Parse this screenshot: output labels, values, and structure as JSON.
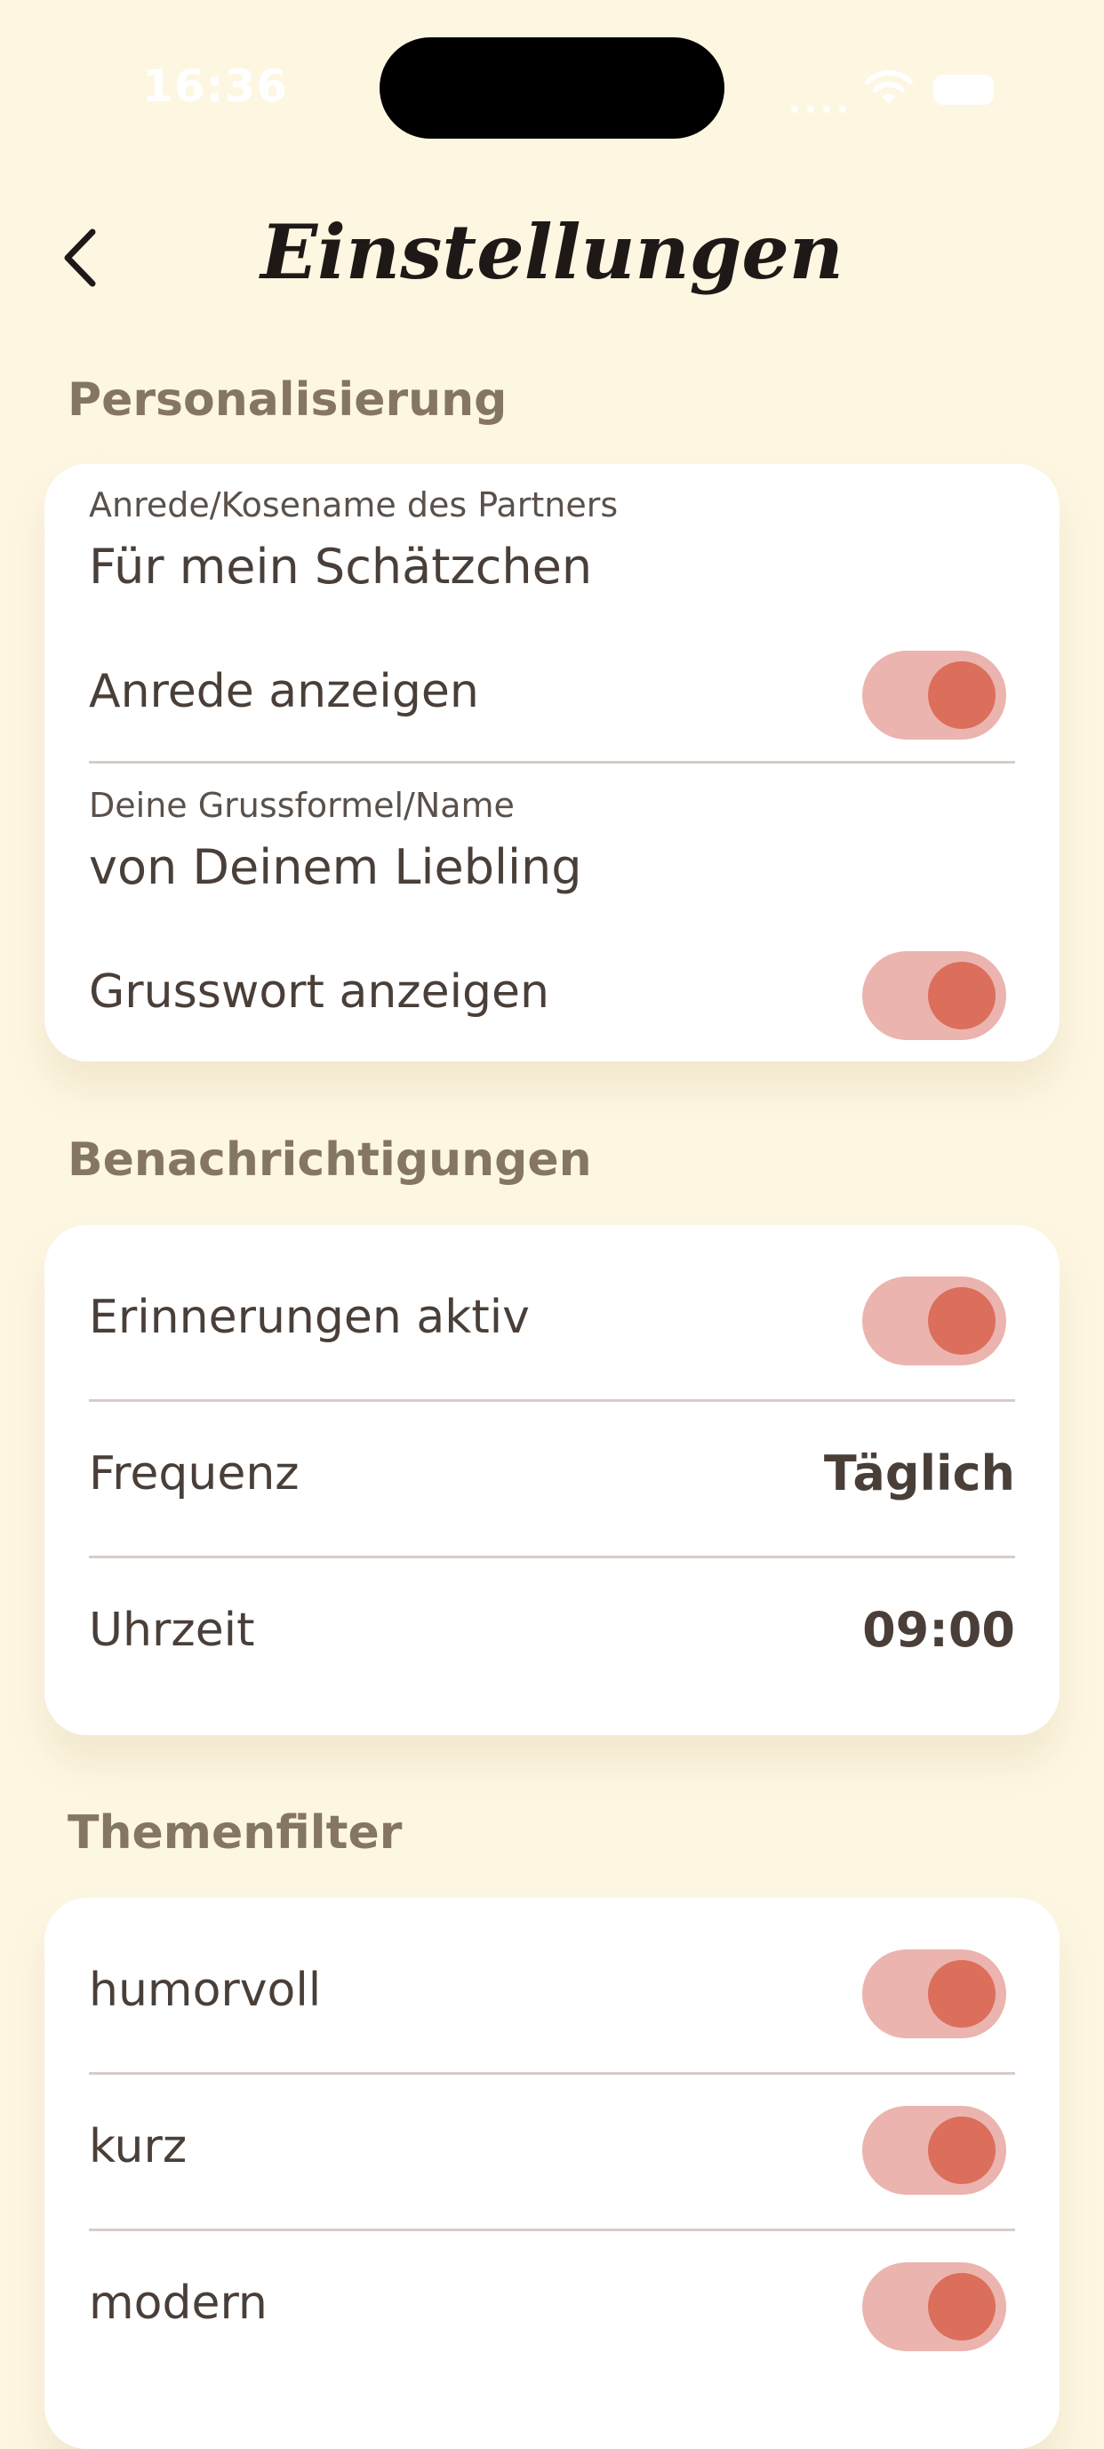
{
  "status_bar": {
    "time": "16:36"
  },
  "header": {
    "title": "Einstellungen",
    "back_icon": "chevron-left-icon"
  },
  "sections": {
    "personalization": {
      "title": "Personalisierung",
      "partner_label": "Anrede/Kosename des Partners",
      "partner_value": "Für mein Schätzchen",
      "show_salutation_label": "Anrede anzeigen",
      "show_salutation_on": true,
      "greeting_label": "Deine Grussformel/Name",
      "greeting_value": "von Deinem Liebling",
      "show_greeting_label": "Grusswort anzeigen",
      "show_greeting_on": true
    },
    "notifications": {
      "title": "Benachrichtigungen",
      "reminders_label": "Erinnerungen aktiv",
      "reminders_on": true,
      "frequency_label": "Frequenz",
      "frequency_value": "Täglich",
      "time_label": "Uhrzeit",
      "time_value": "09:00"
    },
    "topics": {
      "title": "Themenfilter",
      "items": [
        {
          "label": "humorvoll",
          "on": true
        },
        {
          "label": "kurz",
          "on": true
        },
        {
          "label": "modern",
          "on": true
        }
      ]
    }
  },
  "colors": {
    "background": "#FDF6E1",
    "card": "#FFFFFF",
    "toggle_track": "#EBB4AE",
    "toggle_knob": "#DC6E5C",
    "section_header": "#857664"
  }
}
